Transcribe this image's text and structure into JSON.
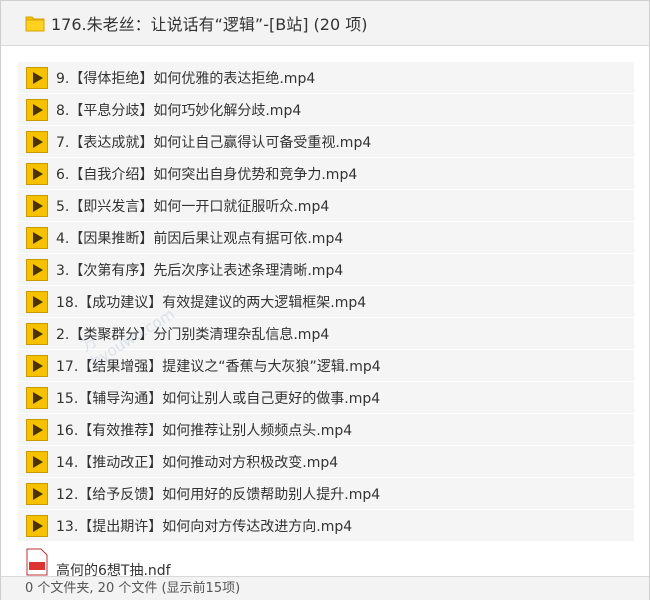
{
  "header": {
    "title": "176.朱老丝：让说话有“逻辑”-[B站] (20 项)",
    "folder_icon": "folder-icon",
    "accent_color": "#f6c200"
  },
  "files": [
    {
      "name": "9.【得体拒绝】如何优雅的表达拒绝.mp4",
      "icon": "video-play-icon"
    },
    {
      "name": "8.【平息分歧】如何巧妙化解分歧.mp4",
      "icon": "video-play-icon"
    },
    {
      "name": "7.【表达成就】如何让自己赢得认可备受重视.mp4",
      "icon": "video-play-icon"
    },
    {
      "name": "6.【自我介绍】如何突出自身优势和竞争力.mp4",
      "icon": "video-play-icon"
    },
    {
      "name": "5.【即兴发言】如何一开口就征服听众.mp4",
      "icon": "video-play-icon"
    },
    {
      "name": "4.【因果推断】前因后果让观点有据可依.mp4",
      "icon": "video-play-icon"
    },
    {
      "name": "3.【次第有序】先后次序让表述条理清晰.mp4",
      "icon": "video-play-icon"
    },
    {
      "name": "18.【成功建议】有效提建议的两大逻辑框架.mp4",
      "icon": "video-play-icon"
    },
    {
      "name": "2.【类聚群分】分门别类清理杂乱信息.mp4",
      "icon": "video-play-icon"
    },
    {
      "name": "17.【结果增强】提建议之“香蕉与大灰狼”逻辑.mp4",
      "icon": "video-play-icon"
    },
    {
      "name": "15.【辅导沟通】如何让别人或自己更好的做事.mp4",
      "icon": "video-play-icon"
    },
    {
      "name": "16.【有效推荐】如何推荐让别人频频点头.mp4",
      "icon": "video-play-icon"
    },
    {
      "name": "14.【推动改正】如何推动对方积极改变.mp4",
      "icon": "video-play-icon"
    },
    {
      "name": "12.【给予反馈】如何用好的反馈帮助别人提升.mp4",
      "icon": "video-play-icon"
    },
    {
      "name": "13.【提出期许】如何向对方传达改进方向.mp4",
      "icon": "video-play-icon"
    }
  ],
  "partial_file": {
    "name": "高何的6想T抽.ndf",
    "icon": "pdf-icon"
  },
  "footer": {
    "status": "0 个文件夹, 20 个文件 (显示前15项)"
  },
  "watermark": {
    "line1": "万",
    "line2": "byouwo.com"
  }
}
